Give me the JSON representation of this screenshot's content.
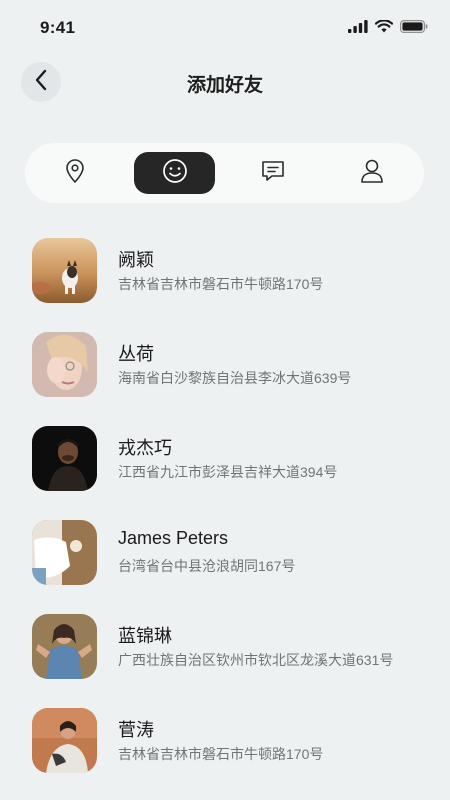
{
  "status_bar": {
    "time": "9:41",
    "icons": [
      "signal-icon",
      "wifi-icon",
      "battery-icon"
    ]
  },
  "header": {
    "back_icon": "chevron-left-icon",
    "title": "添加好友"
  },
  "tabs": [
    {
      "icon": "location-pin-icon",
      "active": false
    },
    {
      "icon": "smiley-face-icon",
      "active": true
    },
    {
      "icon": "message-icon",
      "active": false
    },
    {
      "icon": "user-icon",
      "active": false
    }
  ],
  "colors": {
    "background": "#eef1f2",
    "tab_bar": "#f8f9f9",
    "active_tab": "#262626",
    "name_text": "#1b1b1b",
    "address_text": "#6f7577"
  },
  "friends": [
    {
      "name": "阙颖",
      "address": "吉林省吉林市磐石市牛顿路170号"
    },
    {
      "name": "丛荷",
      "address": "海南省白沙黎族自治县李冰大道639号"
    },
    {
      "name": "戎杰巧",
      "address": "江西省九江市彭泽县吉祥大道394号"
    },
    {
      "name": "James Peters",
      "address": "台湾省台中县沧浪胡同167号"
    },
    {
      "name": "蓝锦琳",
      "address": "广西壮族自治区钦州市钦北区龙溪大道631号"
    },
    {
      "name": "菅涛",
      "address": "吉林省吉林市磐石市牛顿路170号"
    }
  ]
}
